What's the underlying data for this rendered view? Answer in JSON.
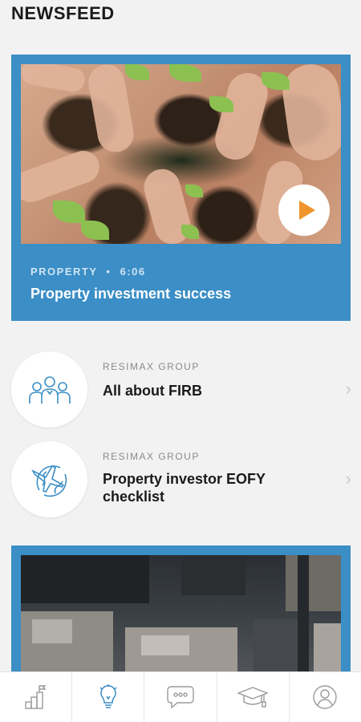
{
  "header": {
    "title": "NEWSFEED"
  },
  "featured": {
    "category": "PROPERTY",
    "separator": "•",
    "duration": "6:06",
    "title": "Property investment success"
  },
  "articles": [
    {
      "source": "RESIMAX GROUP",
      "title": "All about FIRB",
      "icon": "people-group-icon"
    },
    {
      "source": "RESIMAX GROUP",
      "title": "Property investor EOFY checklist",
      "icon": "plane-globe-icon"
    }
  ],
  "bottom_nav": [
    {
      "name": "progress-icon",
      "active": false
    },
    {
      "name": "lightbulb-icon",
      "active": true
    },
    {
      "name": "chat-icon",
      "active": false
    },
    {
      "name": "graduation-cap-icon",
      "active": false
    },
    {
      "name": "profile-icon",
      "active": false
    }
  ],
  "colors": {
    "accent": "#3b8ec6",
    "play": "#f0942b",
    "nav_icon": "#9a9a9a"
  }
}
